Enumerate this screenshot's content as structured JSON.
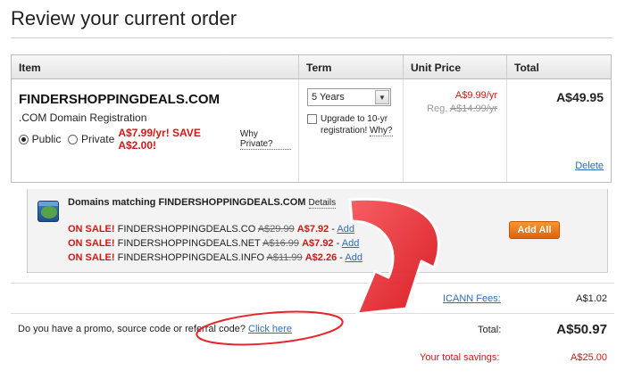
{
  "page": {
    "title": "Review your current order"
  },
  "table": {
    "headers": {
      "item": "Item",
      "term": "Term",
      "unit_price": "Unit Price",
      "total": "Total"
    },
    "row": {
      "domain": "FINDERSHOPPINGDEALS.COM",
      "type": ".COM Domain Registration",
      "public_label": "Public",
      "private_label": "Private",
      "private_offer": "A$7.99/yr! SAVE A$2.00!",
      "why_private": "Why Private?",
      "term_select": "5 Years",
      "upgrade_text": "Upgrade to 10-yr registration!",
      "upgrade_why": "Why?",
      "sale_price": "A$9.99/yr",
      "reg_label": "Reg.",
      "reg_price": "A$14.99/yr",
      "total": "A$49.95",
      "delete": "Delete"
    }
  },
  "matches": {
    "title": "Domains matching FINDERSHOPPINGDEALS.COM",
    "details": "Details",
    "onsale": "ON SALE!",
    "add": "Add",
    "items": [
      {
        "domain": "FINDERSHOPPINGDEALS.CO",
        "old": "A$29.99",
        "new": "A$7.92"
      },
      {
        "domain": "FINDERSHOPPINGDEALS.NET",
        "old": "A$16.99",
        "new": "A$7.92"
      },
      {
        "domain": "FINDERSHOPPINGDEALS.INFO",
        "old": "A$11.99",
        "new": "A$2.26"
      }
    ],
    "add_all": "Add All"
  },
  "summary": {
    "icann_label": "ICANN Fees:",
    "icann_value": "A$1.02",
    "promo_text": "Do you have a promo, source code or referral code?",
    "promo_link": "Click here",
    "total_label": "Total:",
    "total_value": "A$50.97",
    "savings_label": "Your total savings:",
    "savings_value": "A$25.00"
  },
  "colors": {
    "sale_red": "#d41616",
    "link_blue": "#2a6ebb",
    "button_orange": "#f0811c",
    "annotation_red": "#e8232a"
  }
}
